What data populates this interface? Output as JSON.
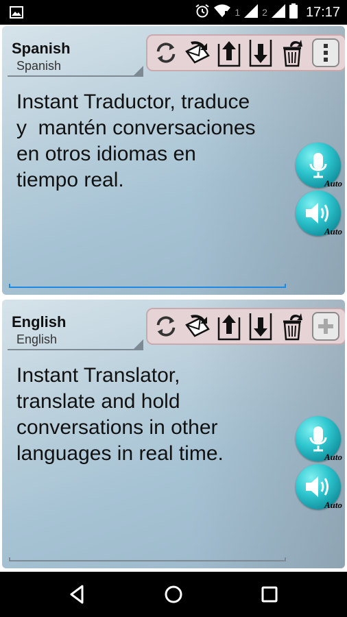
{
  "status_bar": {
    "time": "17:17",
    "sim1": "1",
    "sim2": "2"
  },
  "panels": [
    {
      "language_title": "Spanish",
      "language_subtitle": "Spanish",
      "text": "Instant Traductor, traduce\ny  mantén conversaciones\nen otros idiomas en\ntiempo real.",
      "mic_badge": "Auto",
      "speaker_badge": "Auto",
      "underline_color": "#1e88e5",
      "last_tool": "more-options"
    },
    {
      "language_title": "English",
      "language_subtitle": "English",
      "text": "Instant Translator,\ntranslate and hold\nconversations in other\nlanguages in real time.",
      "mic_badge": "Auto",
      "speaker_badge": "Auto",
      "underline_color": "#7d8a93",
      "last_tool": "add (disabled)"
    }
  ],
  "colors": {
    "toolbar_bg": "#e6d3d6",
    "button_accent": "#2fc6cf"
  }
}
